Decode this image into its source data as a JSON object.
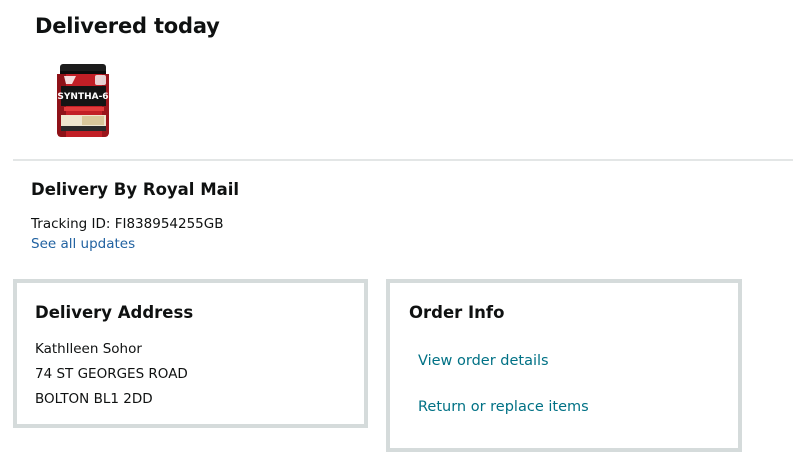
{
  "delivery_status": {
    "title": "Delivered today"
  },
  "product": {
    "image_icon": "protein-tub-product-image",
    "label": "SYNTHA-6"
  },
  "shipment": {
    "carrier_title": "Delivery By Royal Mail",
    "tracking_label": "Tracking ID: ",
    "tracking_id": "FI838954255GB",
    "see_updates_link": "See all updates"
  },
  "address_card": {
    "title": "Delivery Address",
    "lines": [
      "Kathlleen Sohor",
      "74 ST GEORGES ROAD",
      "BOLTON BL1 2DD"
    ]
  },
  "order_info_card": {
    "title": "Order Info",
    "links": [
      "View order details",
      "Return or replace items"
    ]
  },
  "colors": {
    "text": "#0f1111",
    "link_blue": "#2162a1",
    "link_teal": "#007185",
    "card_border": "#d5dbdb",
    "divider": "#e3e6e6"
  }
}
